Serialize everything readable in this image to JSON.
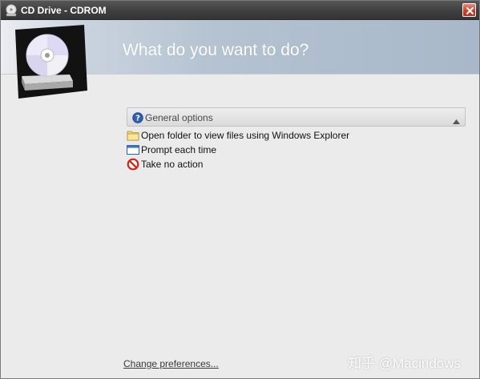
{
  "window": {
    "title": "CD Drive - CDROM",
    "close_icon": "close-icon"
  },
  "header": {
    "title": "What do you want to do?",
    "art_icon": "cd-drive-icon"
  },
  "options_panel": {
    "label": "General options",
    "icon": "help-icon",
    "collapse_icon": "chevron-up-icon",
    "items": [
      {
        "label": "Open folder to view files using Windows Explorer",
        "icon": "folder-icon"
      },
      {
        "label": "Prompt each time",
        "icon": "window-icon"
      },
      {
        "label": "Take no action",
        "icon": "no-action-icon"
      }
    ]
  },
  "footer": {
    "link_label": "Change preferences..."
  },
  "watermark": {
    "text": "知乎 @Macindows"
  },
  "colors": {
    "titlebar": "#3f3f3f",
    "header_band": "#b4c2d1",
    "window_bg": "#ebebeb",
    "close_button": "#c9412e",
    "link": "#3a3a3a"
  }
}
